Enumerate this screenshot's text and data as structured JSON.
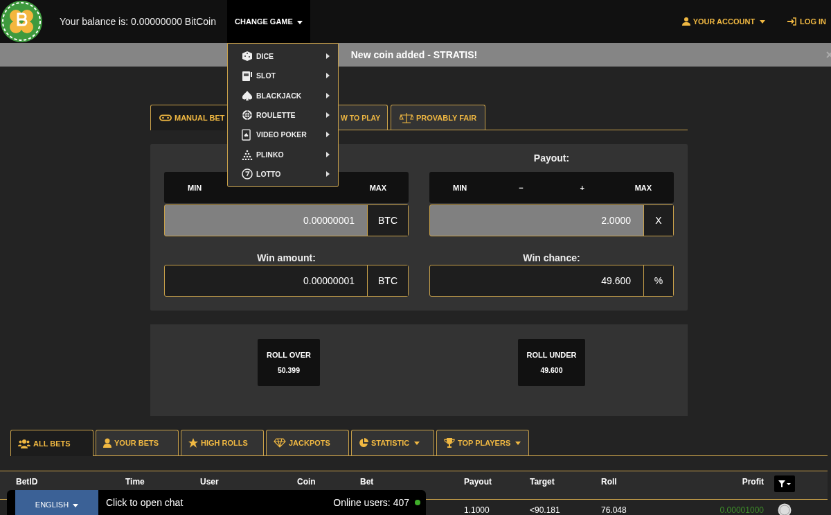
{
  "header": {
    "balance": "Your balance is: 0.00000000 BitCoin",
    "change_game": "CHANGE GAME",
    "account": "YOUR ACCOUNT",
    "login": "LOG IN"
  },
  "game_menu": {
    "expanded": true,
    "items": [
      {
        "label": "DICE",
        "kind": "dice"
      },
      {
        "label": "SLOT",
        "kind": "slot"
      },
      {
        "label": "BLACKJACK",
        "kind": "blackjack"
      },
      {
        "label": "ROULETTE",
        "kind": "roulette"
      },
      {
        "label": "VIDEO POKER",
        "kind": "poker"
      },
      {
        "label": "PLINKO",
        "kind": "plinko"
      },
      {
        "label": "LOTTO",
        "kind": "lotto"
      }
    ]
  },
  "notice": {
    "text": "New coin added - STRATIS!"
  },
  "game_tabs": [
    {
      "label": "MANUAL BET",
      "kind": "manual",
      "selected": true
    },
    {
      "label": "W TO PLAY",
      "kind": "help",
      "selected": false
    },
    {
      "label": "PROVABLY FAIR",
      "kind": "fair",
      "selected": false
    }
  ],
  "bet": {
    "min_button": "MIN",
    "max_button": "MAX",
    "value": "0.00000001",
    "unit": "BTC"
  },
  "payout": {
    "label": "Payout:",
    "buttons": [
      "MIN",
      "−",
      "+",
      "MAX"
    ],
    "value": "2.0000",
    "unit": "X"
  },
  "win_amount": {
    "label": "Win amount:",
    "value": "0.00000001",
    "unit": "BTC"
  },
  "win_chance": {
    "label": "Win chance:",
    "value": "49.600",
    "unit": "%"
  },
  "rolls": [
    {
      "label": "ROLL OVER",
      "value": "50.399"
    },
    {
      "label": "ROLL UNDER",
      "value": "49.600"
    }
  ],
  "bet_tabs": [
    {
      "label": "ALL BETS",
      "kind": "all",
      "selected": true,
      "dropdown": false
    },
    {
      "label": "YOUR BETS",
      "kind": "yours",
      "selected": false,
      "dropdown": false
    },
    {
      "label": "HIGH ROLLS",
      "kind": "high",
      "selected": false,
      "dropdown": false
    },
    {
      "label": "JACKPOTS",
      "kind": "jackpots",
      "selected": false,
      "dropdown": false
    },
    {
      "label": "STATISTIC",
      "kind": "statistic",
      "selected": false,
      "dropdown": true
    },
    {
      "label": "TOP PLAYERS",
      "kind": "top",
      "selected": false,
      "dropdown": true
    }
  ],
  "table": {
    "columns": [
      "BetID",
      "Time",
      "User",
      "Coin",
      "Bet",
      "Payout",
      "Target",
      "Roll",
      "Profit"
    ],
    "rows": [
      {
        "payout": "1.1000",
        "target": "<90.181",
        "roll": "76.048",
        "profit": "0.00001000"
      }
    ]
  },
  "chat": {
    "language": "ENGLISH",
    "prompt": "Click to open chat",
    "online": "Online users: 407"
  }
}
